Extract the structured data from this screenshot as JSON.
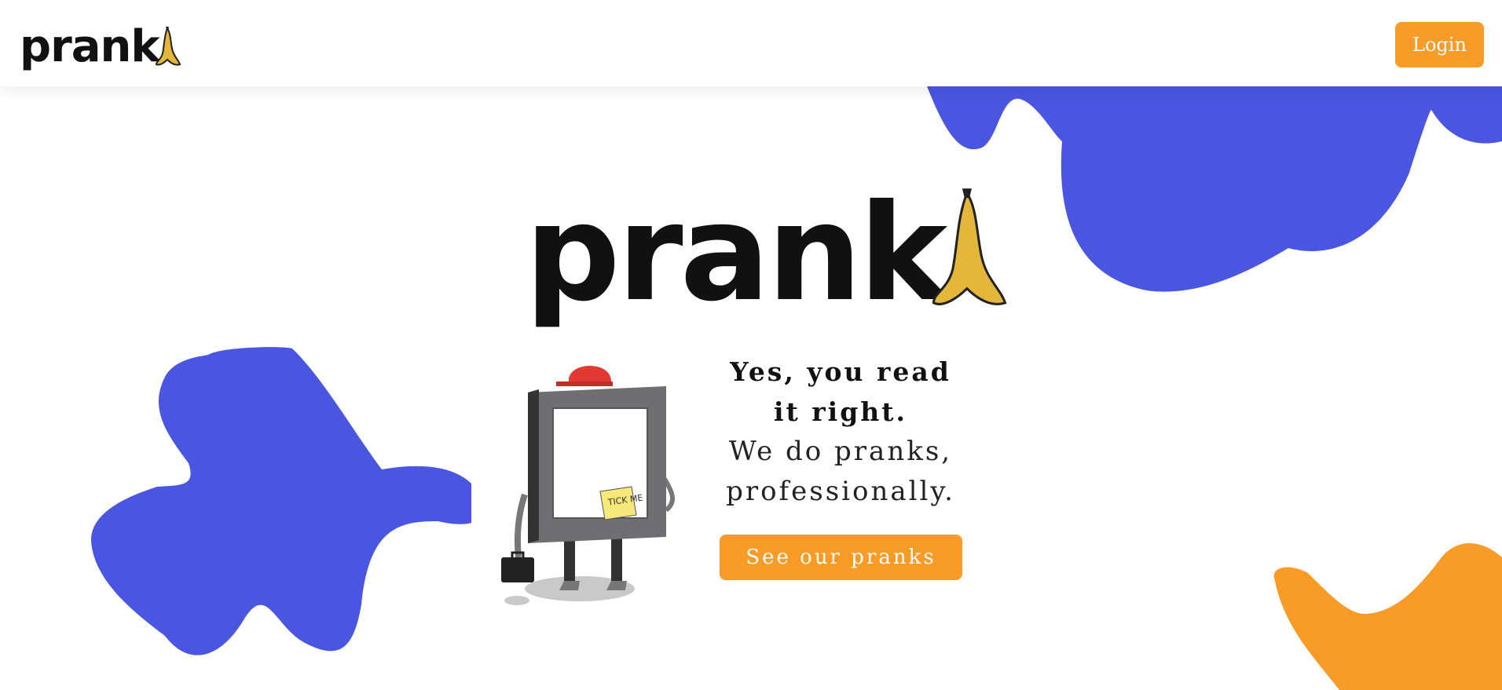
{
  "header": {
    "logo_text": "prank",
    "login_label": "Login"
  },
  "hero": {
    "logo_text": "prank",
    "headline_line1": "Yes, you read",
    "headline_line2": "it right.",
    "subline_line1": "We do pranks,",
    "subline_line2": "professionally.",
    "mascot_note": "TICK ME",
    "cta_label": "See our pranks"
  },
  "colors": {
    "accent_orange": "#F99B27",
    "blob_blue": "#4A55E2",
    "banana_yellow": "#E4B63A"
  },
  "icons": {
    "logo_mark": "banana-peel-icon",
    "mascot": "picture-frame-character"
  }
}
